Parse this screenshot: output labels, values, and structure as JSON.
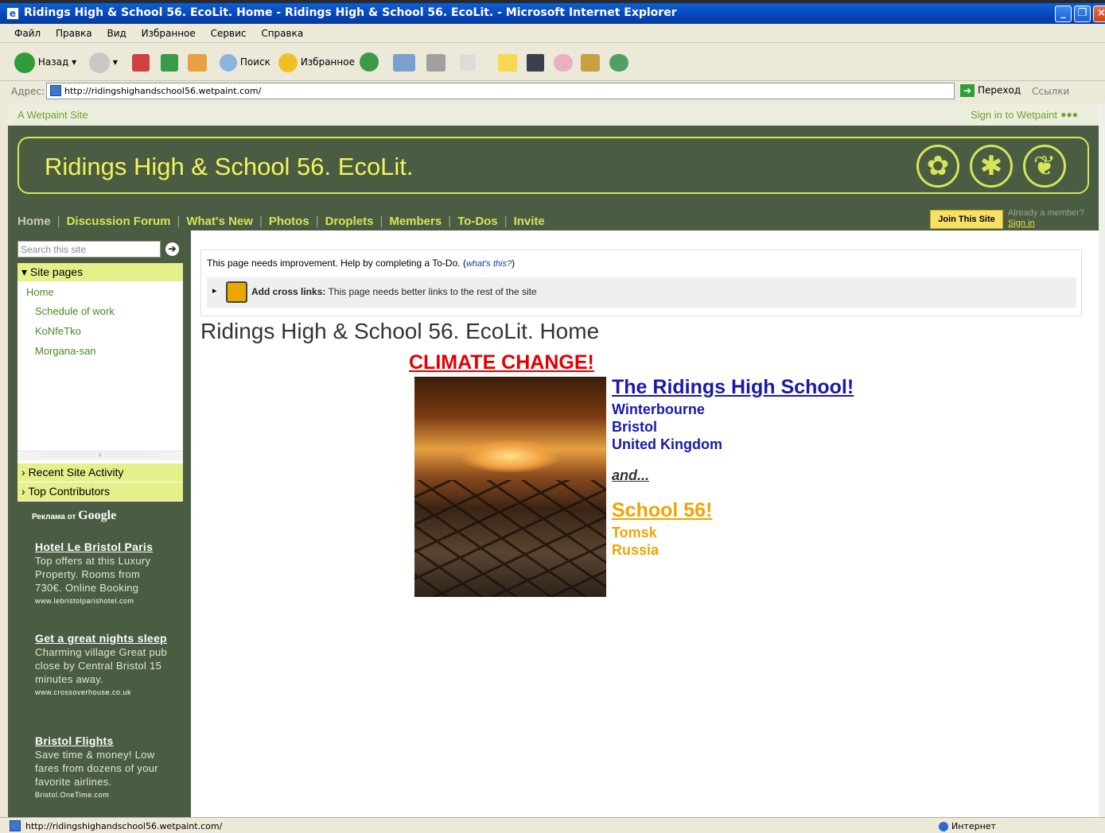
{
  "window": {
    "title": "Ridings High & School 56. EcoLit. Home - Ridings High & School 56. EcoLit. - Microsoft Internet Explorer"
  },
  "menu": [
    "Файл",
    "Правка",
    "Вид",
    "Избранное",
    "Сервис",
    "Справка"
  ],
  "toolbar": {
    "back": "Назад",
    "search": "Поиск",
    "favorites": "Избранное"
  },
  "address": {
    "label": "Адрес:",
    "url": "http://ridingshighandschool56.wetpaint.com/",
    "go": "Переход",
    "links": "Ссылки"
  },
  "wetpaint": {
    "site_label": "A Wetpaint Site",
    "sign_in": "Sign in to Wetpaint"
  },
  "site": {
    "title": "Ridings High & School 56. EcoLit."
  },
  "nav": [
    "Home",
    "Discussion Forum",
    "What's New",
    "Photos",
    "Droplets",
    "Members",
    "To-Dos",
    "Invite"
  ],
  "join": {
    "button": "Join This Site",
    "already": "Already a member?",
    "sign_in": "Sign in"
  },
  "sidebar": {
    "search_placeholder": "Search this site",
    "site_pages": "Site pages",
    "pages": [
      "Home",
      "Schedule of work",
      "KoNfeTko",
      "Morgana-san"
    ],
    "recent": "Recent Site Activity",
    "contributors": "Top Contributors",
    "ads_by": "Реклама от",
    "ads_brand": "Google",
    "ads": [
      {
        "title": "Hotel Le Bristol Paris",
        "text": "Top offers at this Luxury Property. Rooms from 730€. Online Booking",
        "url": "www.lebristolparishotel.com"
      },
      {
        "title": "Get a great nights sleep",
        "text": "Charming village Great pub close by Central Bristol 15 minutes away.",
        "url": "www.crossoverhouse.co.uk"
      },
      {
        "title": "Bristol Flights",
        "text": "Save time & money! Low fares from dozens of your favorite airlines.",
        "url": "Bristol.OneTime.com"
      }
    ]
  },
  "todo": {
    "message": "This page needs improvement. Help by completing a To-Do. (",
    "whats_this": "what's this?",
    "close_paren": ")",
    "item_label": "Add cross links:",
    "item_text": " This page needs better links to the rest of the site"
  },
  "content": {
    "page_title": "Ridings High & School 56. EcoLit. Home",
    "climate": "CLIMATE CHANGE!",
    "ridings": "The Ridings High School!",
    "ridings_lines": [
      "Winterbourne",
      "Bristol",
      "United Kingdom"
    ],
    "and": "and...",
    "school56": "School 56!",
    "school56_lines": [
      "Tomsk",
      "Russia"
    ]
  },
  "status": {
    "url": "http://ridingshighandschool56.wetpaint.com/",
    "zone": "Интернет"
  }
}
